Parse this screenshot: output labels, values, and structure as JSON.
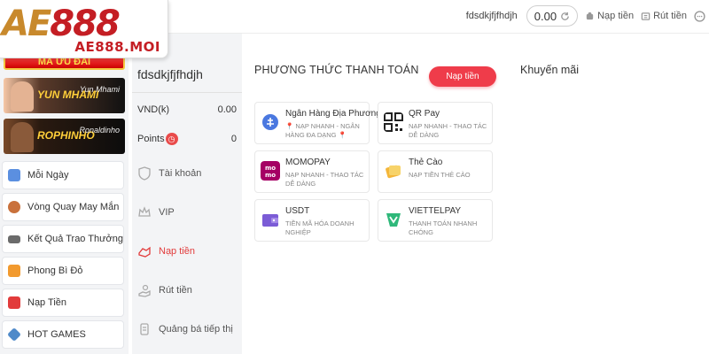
{
  "header": {
    "username": "fdsdkjfjfhdjh",
    "balance": "0.00",
    "deposit_link": "Nạp tiền",
    "withdraw_link": "Rút tiền"
  },
  "logo": {
    "main_left": "AE",
    "main_right": "888",
    "sub": "AE888.MOI"
  },
  "left_sidebar": {
    "promo_strip": "MÃ ƯU ĐÃI",
    "banners": [
      {
        "text": "YUN MHAMI",
        "sign": "Yun Mhami"
      },
      {
        "text": "ROPHINHO",
        "sign": "Ronaldinho"
      }
    ],
    "items": [
      {
        "label": "Mỗi Ngày",
        "icon": "calendar-icon"
      },
      {
        "label": "Vòng Quay May Mắn",
        "icon": "lucky-wheel-icon"
      },
      {
        "label": "Kết Quả Trao Thưởng",
        "icon": "car-icon"
      },
      {
        "label": "Phong Bì Đỏ",
        "icon": "red-envelope-icon"
      },
      {
        "label": "Nạp Tiền",
        "icon": "deposit-icon"
      },
      {
        "label": "HOT GAMES",
        "icon": "diamond-icon"
      }
    ]
  },
  "account_panel": {
    "username": "fdsdkjfjfhdjh",
    "currency_label": "VND(k)",
    "currency_value": "0.00",
    "points_label": "Points",
    "points_value": "0",
    "menu": [
      {
        "label": "Tài khoản",
        "icon": "shield-icon",
        "active": false
      },
      {
        "label": "VIP",
        "icon": "vip-crown-icon",
        "active": false
      },
      {
        "label": "Nạp tiền",
        "icon": "deposit-hand-icon",
        "active": true
      },
      {
        "label": "Rút tiền",
        "icon": "withdraw-hand-icon",
        "active": false
      },
      {
        "label": "Quảng bá tiếp thị",
        "icon": "marketing-icon",
        "active": false
      }
    ]
  },
  "payment": {
    "title": "PHƯƠNG THỨC THANH TOÁN",
    "deposit_button": "Nạp tiền",
    "methods": [
      {
        "name": "Ngân Hàng Địa Phương",
        "desc": "📍 NẠP NHANH - NGÂN HÀNG ĐA DẠNG 📍",
        "icon": "bank-icon"
      },
      {
        "name": "QR Pay",
        "desc": "NẠP NHANH - THAO TÁC DỄ DÀNG",
        "icon": "qr-code-icon"
      },
      {
        "name": "MOMOPAY",
        "desc": "NẠP NHANH - THAO TÁC DỄ DÀNG",
        "icon": "momo-icon"
      },
      {
        "name": "Thẻ Cào",
        "desc": "NẠP TIỀN THẺ CÀO",
        "icon": "scratch-card-icon"
      },
      {
        "name": "USDT",
        "desc": "TIỀN MÃ HÓA DOANH NGHIỆP",
        "icon": "usdt-wallet-icon"
      },
      {
        "name": "VIETTELPAY",
        "desc": "THANH TOÁN NHANH CHÓNG",
        "icon": "viettelpay-icon"
      }
    ]
  },
  "promotions": {
    "title": "Khuyến mãi"
  },
  "colors": {
    "accent": "#ef3c4a",
    "brand_gold": "#c8892c",
    "brand_red": "#c41e24",
    "sidebar_bg": "#f3f4f6"
  }
}
